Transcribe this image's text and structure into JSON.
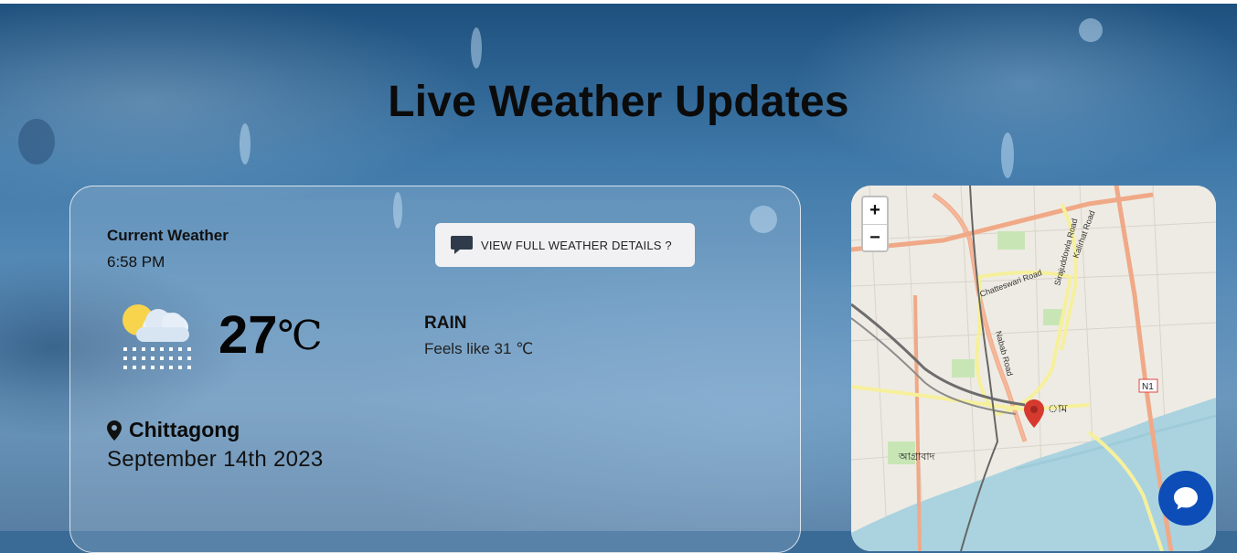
{
  "page": {
    "title": "Live Weather Updates"
  },
  "current": {
    "label": "Current Weather",
    "time": "6:58 PM",
    "details_button": "VIEW FULL WEATHER DETAILS ?",
    "details_icon": "chat-bubble-icon",
    "weather_icon": "cloud-sun-rain-icon",
    "temp_value": "27",
    "temp_unit": "℃",
    "condition": "RAIN",
    "feels_like": "Feels like 31 ℃",
    "location_icon": "location-pin-icon",
    "city": "Chittagong",
    "date": "September 14th 2023"
  },
  "map": {
    "zoom_in": "+",
    "zoom_out": "−",
    "labels": {
      "road_chatteswari": "Chatteswari Road",
      "road_siraj": "Sirajuddowla Road",
      "road_kalirhat": "Kalirhat Road",
      "road_nabab": "Nabab Road",
      "badge_n1": "N1",
      "area_agrabad": "আগ্রাবাদ",
      "area_city": "াম"
    },
    "marker_icon": "map-marker-icon"
  },
  "chat_widget": {
    "icon": "chat-widget-icon"
  },
  "colors": {
    "accent_chat": "#0d4db8",
    "marker_red": "#d63a2f",
    "river": "#aad3df"
  }
}
